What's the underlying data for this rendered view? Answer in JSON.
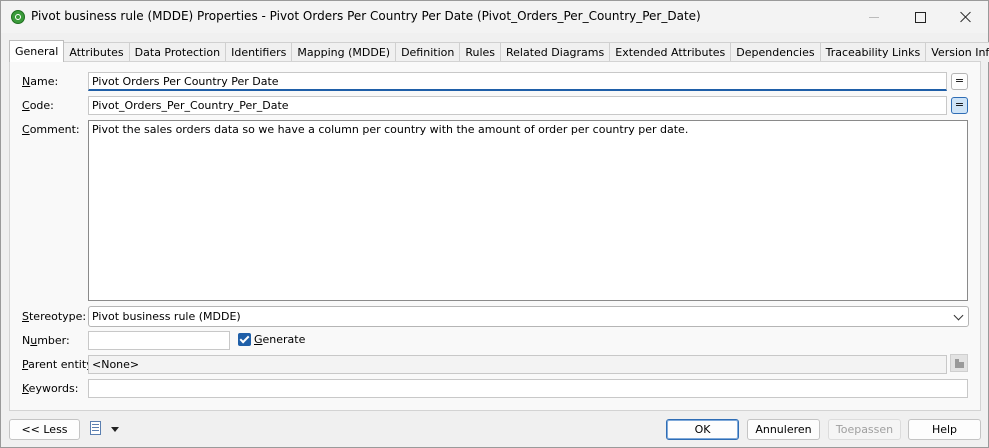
{
  "window": {
    "title": "Pivot business rule (MDDE) Properties - Pivot Orders Per Country Per Date (Pivot_Orders_Per_Country_Per_Date)"
  },
  "tabs": [
    {
      "label": "General",
      "active": true
    },
    {
      "label": "Attributes"
    },
    {
      "label": "Data Protection"
    },
    {
      "label": "Identifiers"
    },
    {
      "label": "Mapping (MDDE)"
    },
    {
      "label": "Definition"
    },
    {
      "label": "Rules"
    },
    {
      "label": "Related Diagrams"
    },
    {
      "label": "Extended Attributes"
    },
    {
      "label": "Dependencies"
    },
    {
      "label": "Traceability Links"
    },
    {
      "label": "Version Info"
    }
  ],
  "form": {
    "name_label_mnemonic": "N",
    "name_label_rest": "ame:",
    "name_value": "Pivot Orders Per Country Per Date",
    "code_label_mnemonic": "C",
    "code_label_rest": "ode:",
    "code_value": "Pivot_Orders_Per_Country_Per_Date",
    "comment_label_mnemonic": "C",
    "comment_label_rest": "omment:",
    "comment_value": "Pivot the sales orders data so we have a column per country with the amount of order per country per date.",
    "stereotype_label_mnemonic": "S",
    "stereotype_label_rest": "tereotype:",
    "stereotype_value": "Pivot business rule (MDDE)",
    "number_label_pre": "N",
    "number_label_mnemonic": "u",
    "number_label_rest": "mber:",
    "number_value": "",
    "generate_label_mnemonic": "G",
    "generate_label_rest": "enerate",
    "generate_checked": true,
    "parent_entity_label_mnemonic": "P",
    "parent_entity_label_rest": "arent entity:",
    "parent_entity_value": "<None>",
    "keywords_label_mnemonic": "K",
    "keywords_label_rest": "eywords:",
    "keywords_value": "",
    "eq_symbol": "="
  },
  "footer": {
    "less_label": "<< Less",
    "ok_label": "OK",
    "cancel_label": "Annuleren",
    "apply_label": "Toepassen",
    "help_label": "Help"
  }
}
